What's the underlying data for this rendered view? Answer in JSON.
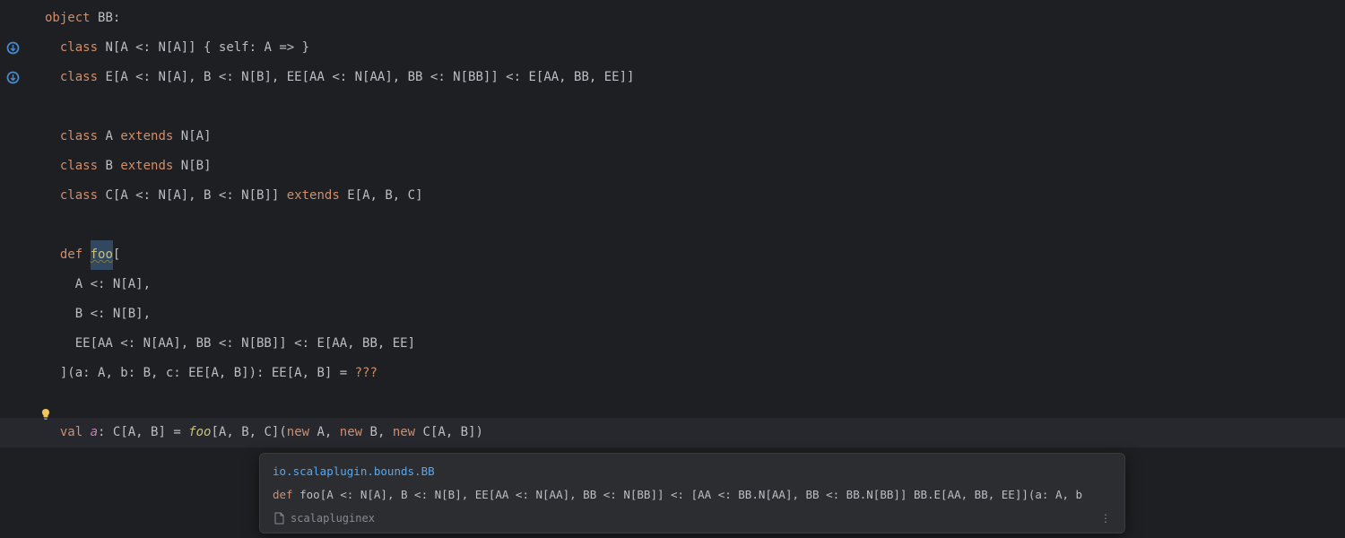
{
  "colors": {
    "background": "#1e1f22",
    "keyword": "#cf8e6d",
    "function": "#56a8f5",
    "funcDef": "#c8c07d",
    "text": "#bcbec4",
    "valName": "#c77dbb",
    "tooltipBg": "#2b2d30",
    "tooltipBorder": "#393b40"
  },
  "code": {
    "line1": {
      "kw": "object",
      "name": "BB",
      "colon": ":"
    },
    "line2": {
      "kw": "class",
      "name": "N",
      "params": "[A <: N[A]] { self: A => }"
    },
    "line3": {
      "kw": "class",
      "name": "E",
      "params": "[A <: N[A], B <: N[B], EE[AA <: N[AA], BB <: N[BB]] <: E[AA, BB, EE]]"
    },
    "line5": {
      "kw": "class",
      "name": "A",
      "kw2": "extends",
      "ext": "N[A]"
    },
    "line6": {
      "kw": "class",
      "name": "B",
      "kw2": "extends",
      "ext": "N[B]"
    },
    "line7": {
      "kw": "class",
      "name": "C",
      "params": "[A <: N[A], B <: N[B]]",
      "kw2": "extends",
      "ext": "E[A, B, C]"
    },
    "line9": {
      "kw": "def",
      "name": "foo",
      "open": "["
    },
    "line10": {
      "text": "A <: N[A],"
    },
    "line11": {
      "text": "B <: N[B],"
    },
    "line12": {
      "text": "EE[AA <: N[AA], BB <: N[BB]] <: E[AA, BB, EE]"
    },
    "line13": {
      "close": "]",
      "params": "(a: A, b: B, c: EE[A, B]): EE[A, B] = ",
      "qmark": "???"
    },
    "line15": {
      "kw": "val",
      "name": "a",
      "colon": ": ",
      "typeC": "C",
      "typeRest": "[A, B] = ",
      "call": "foo",
      "callRest": "[A, B, C](",
      "new1": "new",
      "sp1": " A, ",
      "new2": "new",
      "sp2": " B, ",
      "new3": "new",
      "sp3": " C[A, B])"
    }
  },
  "tooltip": {
    "breadcrumb": "io.scalaplugin.bounds.BB",
    "sigKw": "def",
    "sigName": " foo",
    "sigRest": "[A <: N[A], B <: N[B], EE[AA <: N[AA], BB <: N[BB]] <: [AA <: BB.N[AA], BB <: BB.N[BB]] BB.E[AA, BB, EE]](a: A, b",
    "footerFile": "scalapluginex"
  },
  "icons": {
    "bulb": "💡",
    "override": "override-icon"
  }
}
